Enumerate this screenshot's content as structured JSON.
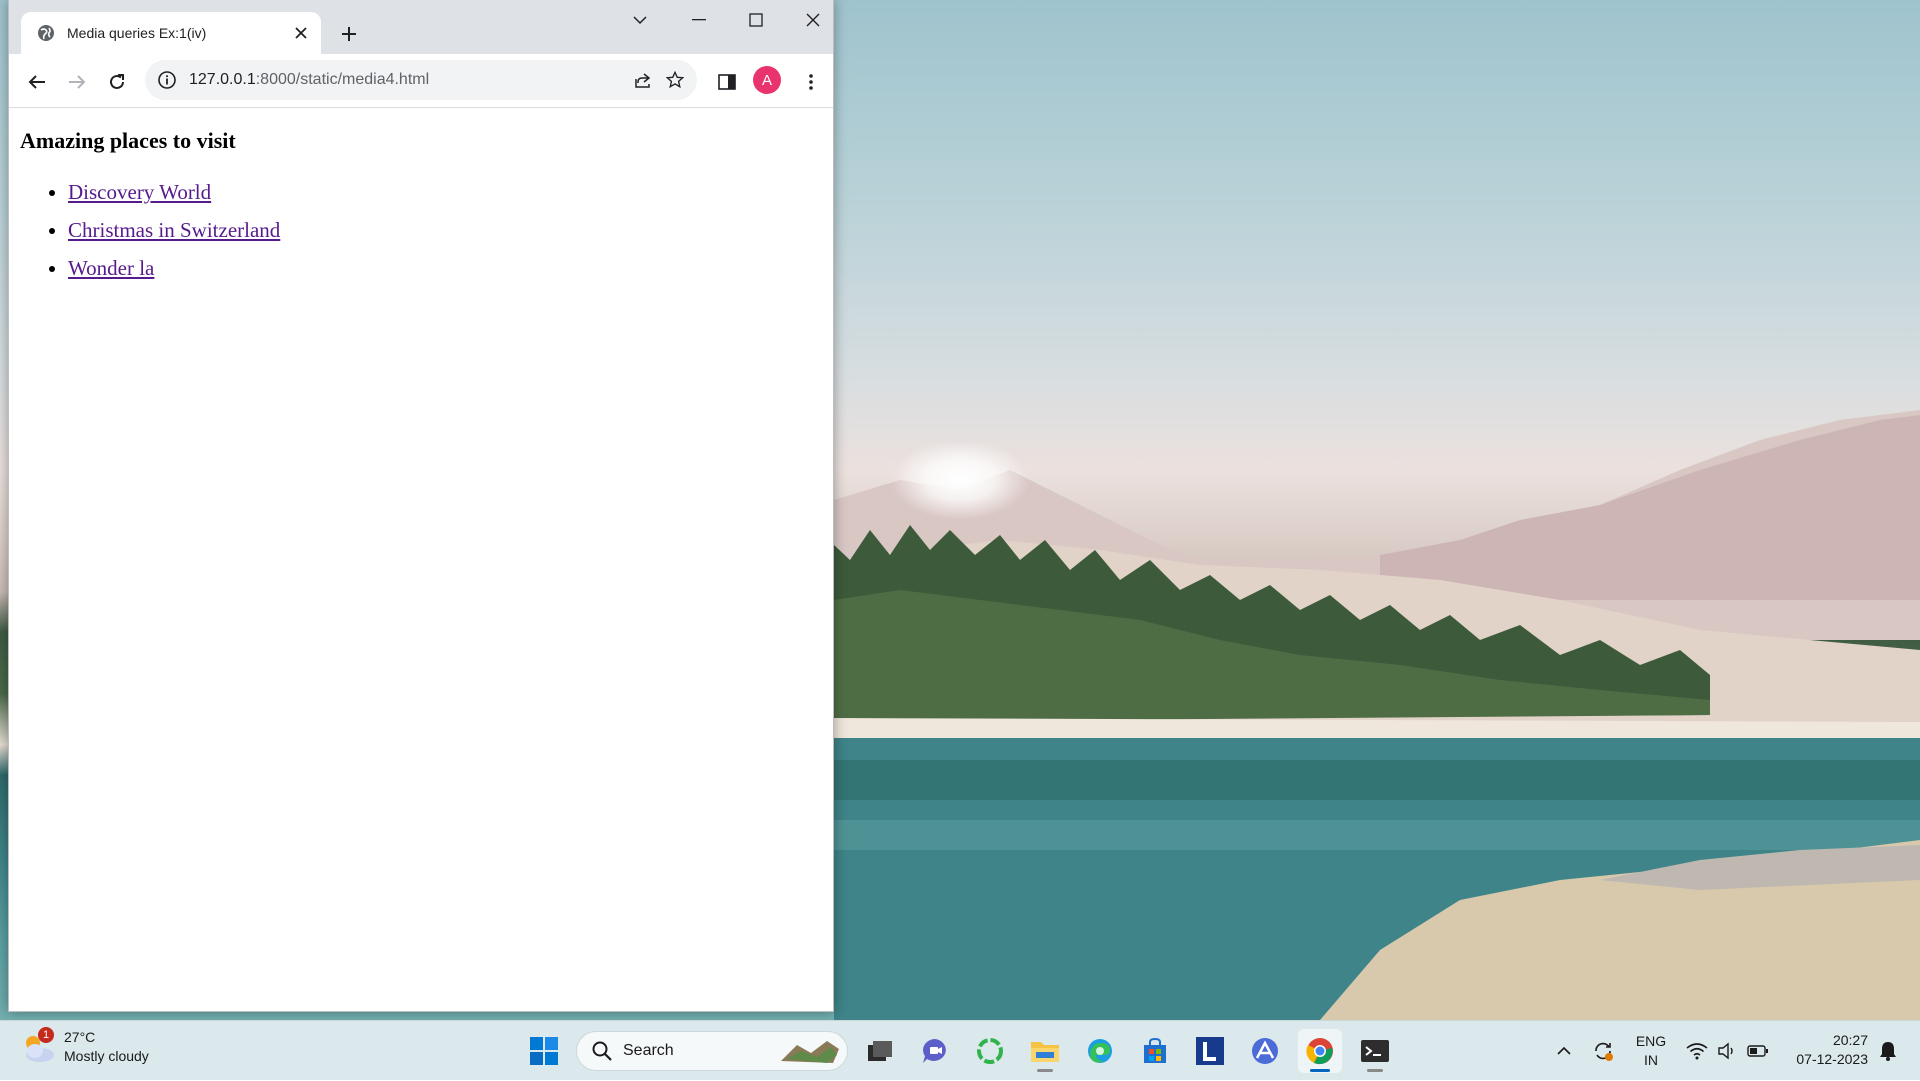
{
  "browser": {
    "tab_title": "Media queries Ex:1(iv)",
    "url_host": "127.0.0.1",
    "url_path": ":8000/static/media4.html",
    "profile_initial": "A"
  },
  "page": {
    "heading": "Amazing places to visit",
    "links": [
      {
        "label": "Discovery World"
      },
      {
        "label": "Christmas in Switzerland"
      },
      {
        "label": "Wonder la"
      }
    ]
  },
  "taskbar": {
    "weather": {
      "temp": "27°C",
      "condition": "Mostly cloudy",
      "badge": "1"
    },
    "search_label": "Search",
    "language": {
      "line1": "ENG",
      "line2": "IN"
    },
    "clock": {
      "time": "20:27",
      "date": "07-12-2023"
    },
    "apps": [
      "start",
      "search",
      "task-view",
      "teams-chat",
      "circle-app",
      "file-explorer",
      "edge",
      "microsoft-store",
      "l-app",
      "arc-app",
      "chrome",
      "terminal"
    ]
  },
  "colors": {
    "link_visited": "#551a8b",
    "avatar_bg": "#e8336d",
    "tab_strip": "#dee1e6",
    "taskbar_bg": "#dbe8ec"
  }
}
